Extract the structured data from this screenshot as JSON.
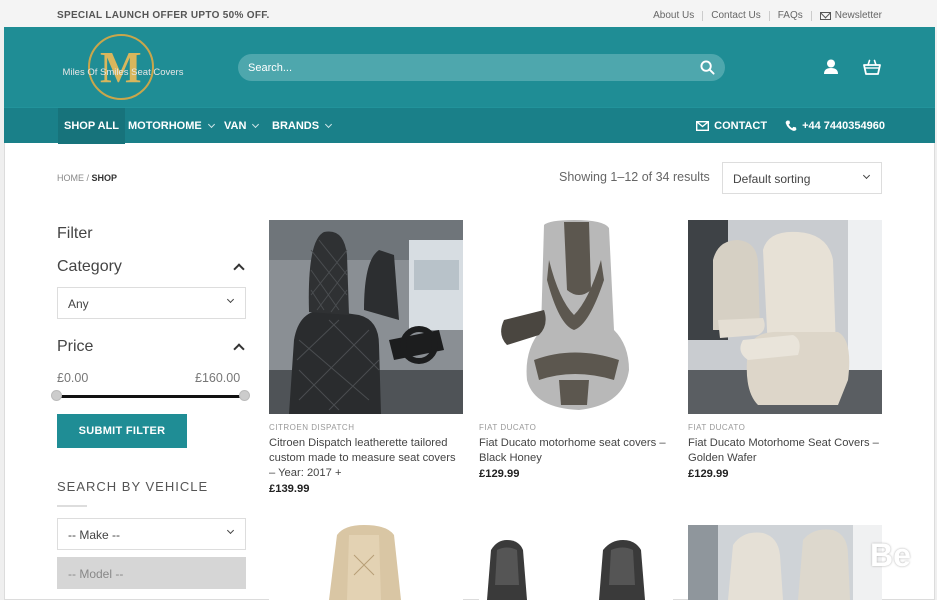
{
  "topbar": {
    "offer": "SPECIAL LAUNCH OFFER UPTO 50% OFF.",
    "links": [
      "About Us",
      "Contact Us",
      "FAQs"
    ],
    "newsletter": "Newsletter"
  },
  "header": {
    "logo_letter": "M",
    "logo_text": "Miles Of Smiles Seat Covers",
    "search_placeholder": "Search...",
    "bg_color": "#1f8d95"
  },
  "nav": {
    "items": [
      "SHOP ALL",
      "MOTORHOME",
      "VAN",
      "BRANDS"
    ],
    "contact": "CONTACT",
    "phone": "+44 7440354960"
  },
  "breadcrumb": {
    "home": "HOME",
    "sep": "/",
    "current": "SHOP"
  },
  "results": {
    "showing": "Showing 1–12 of 34 results",
    "sort_selected": "Default sorting"
  },
  "sidebar": {
    "filter_title": "Filter",
    "category_title": "Category",
    "category_selected": "Any",
    "price_title": "Price",
    "price_min": "£0.00",
    "price_max": "£160.00",
    "price_range_fraction": [
      0,
      1
    ],
    "submit_label": "SUBMIT FILTER",
    "vehicle_title": "SEARCH BY VEHICLE",
    "make_selected": "-- Make --",
    "model_selected": "-- Model --"
  },
  "products": [
    {
      "category": "CITROEN DISPATCH",
      "name": "Citroen Dispatch leatherette tailored custom made to measure seat covers – Year: 2017 +",
      "price": "£139.99"
    },
    {
      "category": "FIAT DUCATO",
      "name": "Fiat Ducato motorhome seat covers – Black Honey",
      "price": "£129.99"
    },
    {
      "category": "FIAT DUCATO",
      "name": "Fiat Ducato Motorhome Seat Covers – Golden Wafer",
      "price": "£129.99"
    }
  ],
  "watermark": "Be"
}
